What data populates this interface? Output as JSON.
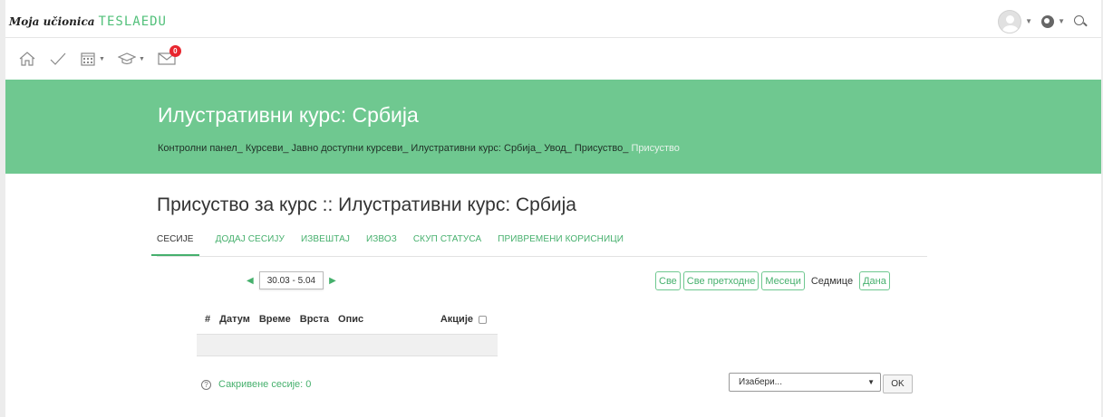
{
  "navbar": {
    "logo_script": "Moja učionica",
    "logo_brand": "TESLAEDU"
  },
  "toolbar": {
    "messages_badge": "0"
  },
  "hero": {
    "title": "Илустративни курс: Србија",
    "breadcrumb": [
      "Контролни панел",
      "Курсеви",
      "Јавно доступни курсеви",
      "Илустративни курс: Србија",
      "Увод",
      "Присуство",
      "Присуство"
    ]
  },
  "main": {
    "heading": "Присуство за курс :: Илустративни курс: Србија",
    "tabs": [
      {
        "label": "СЕСИЈЕ",
        "active": true
      },
      {
        "label": "ДОДАЈ СЕСИЈУ",
        "active": false
      },
      {
        "label": "ИЗВЕШТАЈ",
        "active": false
      },
      {
        "label": "ИЗВОЗ",
        "active": false
      },
      {
        "label": "СКУП СТАТУСА",
        "active": false
      },
      {
        "label": "ПРИВРЕМЕНИ КОРИСНИЦИ",
        "active": false
      }
    ],
    "date_range": "30.03 - 5.04",
    "view_buttons": [
      "Све",
      "Све претходне",
      "Месеци",
      "Седмице",
      "Дана"
    ],
    "current_view": "Седмице",
    "table_headers": {
      "hash": "#",
      "date": "Датум",
      "time": "Време",
      "type": "Врста",
      "description": "Опис",
      "actions": "Акције"
    },
    "hidden_sessions": "Сакривене сесије: 0",
    "select_placeholder": "Изабери...",
    "ok_label": "OK"
  },
  "colors": {
    "brand_green": "#6fc890",
    "link_green": "#46b06d",
    "badge_red": "#e8262f"
  },
  "icons": [
    "home-icon",
    "check-icon",
    "calendar-icon",
    "graduation-cap-icon",
    "envelope-icon",
    "avatar-icon",
    "globe-icon",
    "search-icon",
    "help-icon"
  ]
}
